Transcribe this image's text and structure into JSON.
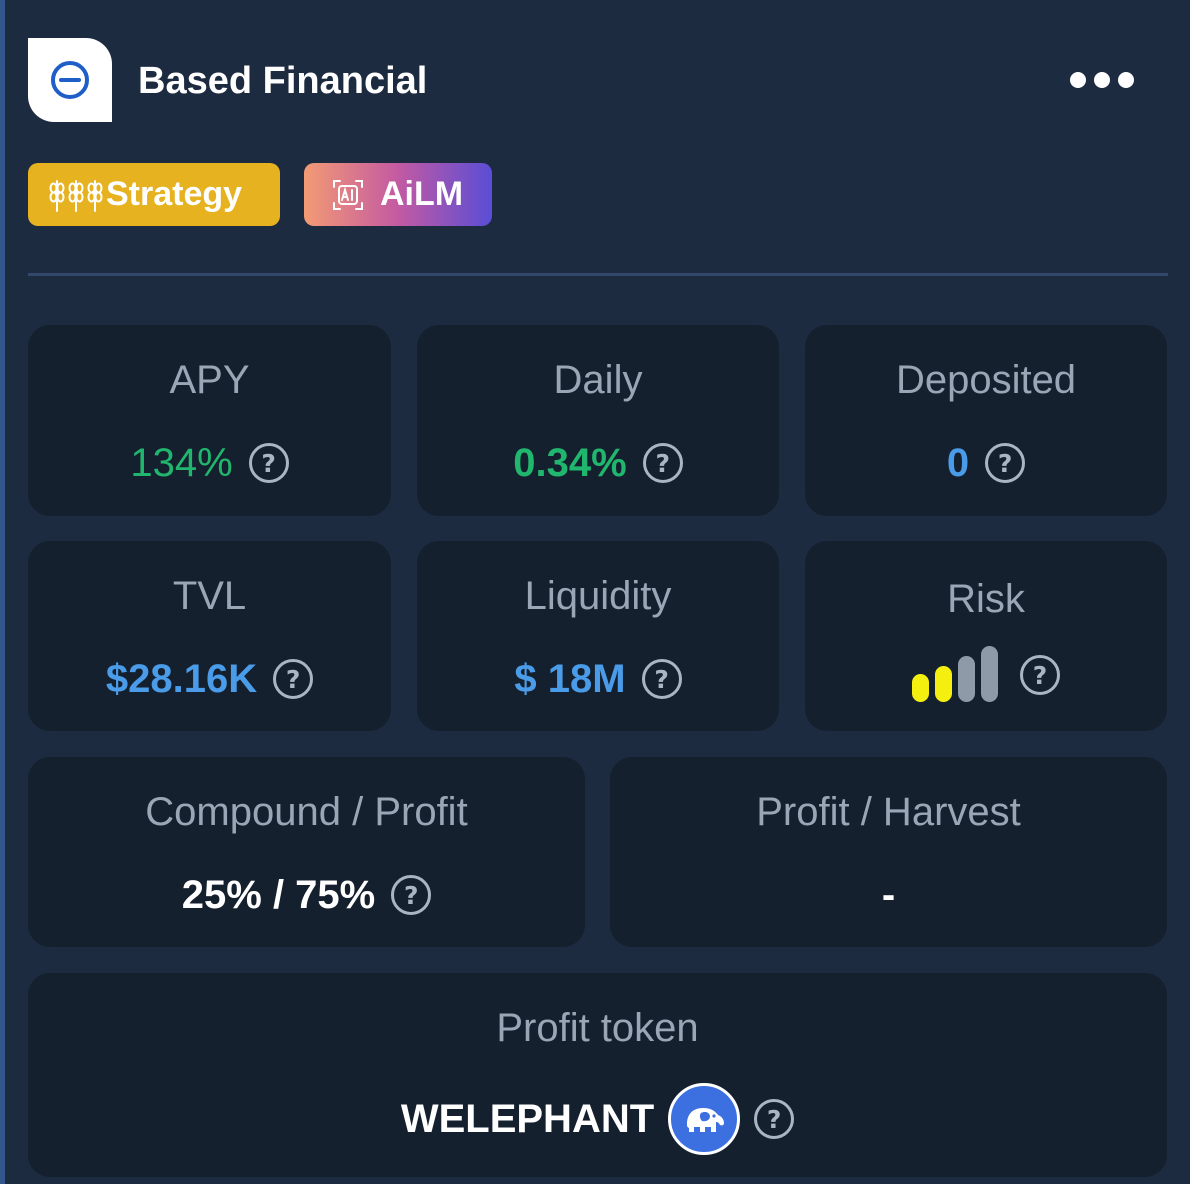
{
  "app": {
    "title": "Based Financial",
    "logo_icon": "circle-minus-icon",
    "more_icon": "ellipsis-icon"
  },
  "badges": [
    {
      "label": "Strategy",
      "icon": "wheat-icon",
      "color": "#e7b21f"
    },
    {
      "label": "AiLM",
      "icon": "ai-chip-icon"
    }
  ],
  "stats": {
    "apy": {
      "label": "APY",
      "value": "134%",
      "color": "#21b66e"
    },
    "daily": {
      "label": "Daily",
      "value": "0.34%",
      "color": "#21b66e"
    },
    "deposited": {
      "label": "Deposited",
      "value": "0",
      "color": "#4a9be8"
    },
    "tvl": {
      "label": "TVL",
      "value": "$28.16K",
      "color": "#4a9be8"
    },
    "liquidity": {
      "label": "Liquidity",
      "value": "$ 18M",
      "color": "#4a9be8"
    },
    "risk": {
      "label": "Risk",
      "level": 2,
      "max": 4,
      "active_color": "#f5ef10",
      "inactive_color": "#8e9aa8"
    },
    "compound_profit": {
      "label": "Compound / Profit",
      "value": "25% / 75%"
    },
    "profit_harvest": {
      "label": "Profit / Harvest",
      "value": "-"
    },
    "profit_token": {
      "label": "Profit token",
      "value": "WELEPHANT",
      "icon": "elephant-icon"
    }
  },
  "help_glyph": "?"
}
